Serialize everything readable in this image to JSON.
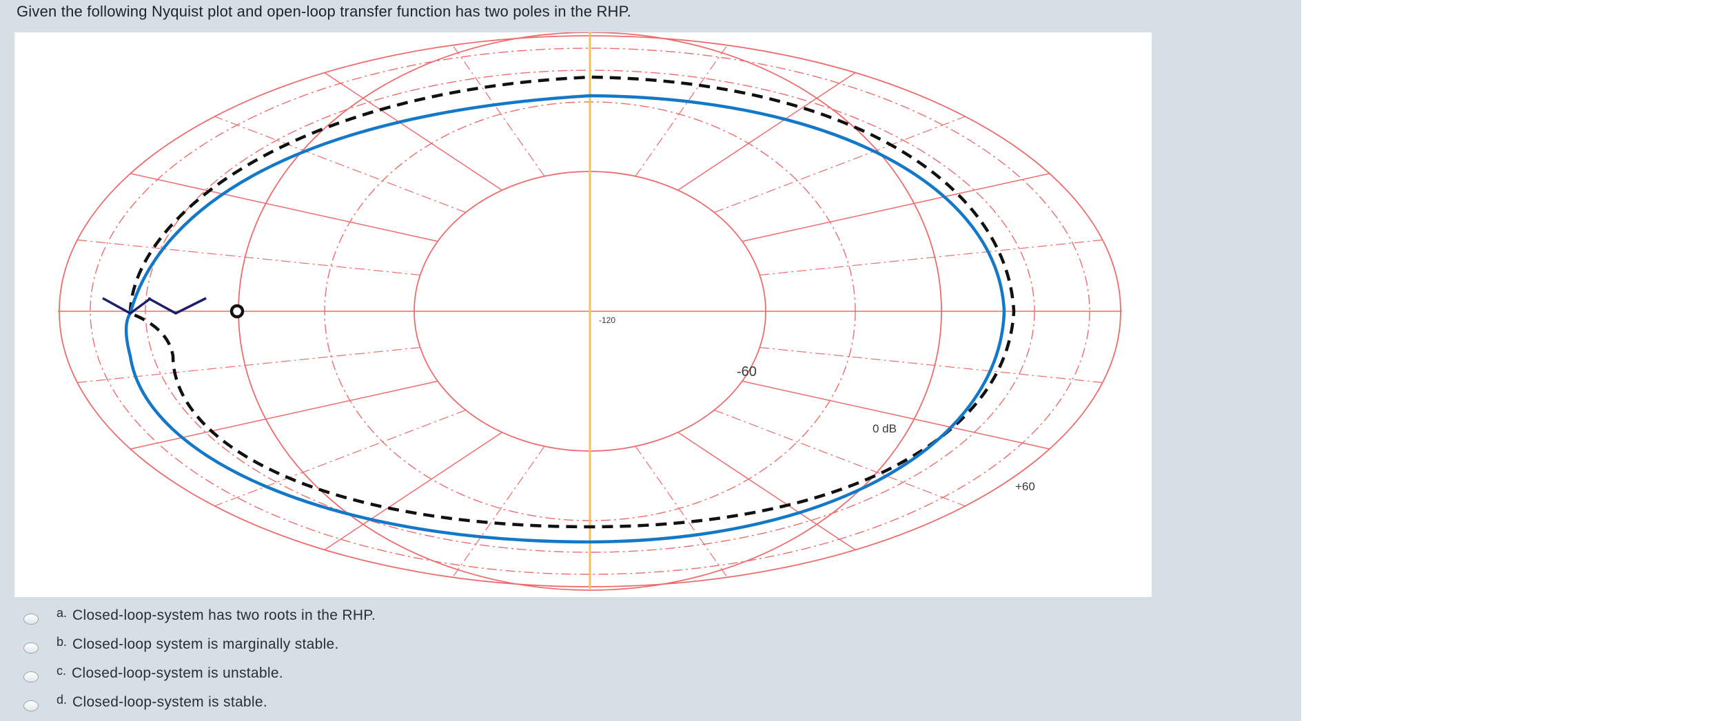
{
  "question": {
    "text": "Given the following Nyquist plot and open-loop transfer function has two poles in the RHP."
  },
  "plot": {
    "labels": {
      "center": "-120",
      "inner": "-60",
      "middle": "0 dB",
      "outer": "+60"
    },
    "colors": {
      "grid": "#ee6b6b",
      "imag_axis": "#f2c060",
      "curve": "#1478c8",
      "mirror_curve": "#111111",
      "critical_point": "#111111"
    }
  },
  "options": [
    {
      "letter": "a.",
      "text": "Closed-loop-system has two roots in the RHP."
    },
    {
      "letter": "b.",
      "text": "Closed-loop system is marginally stable."
    },
    {
      "letter": "c.",
      "text": "Closed-loop-system is unstable."
    },
    {
      "letter": "d.",
      "text": "Closed-loop-system is stable."
    }
  ]
}
